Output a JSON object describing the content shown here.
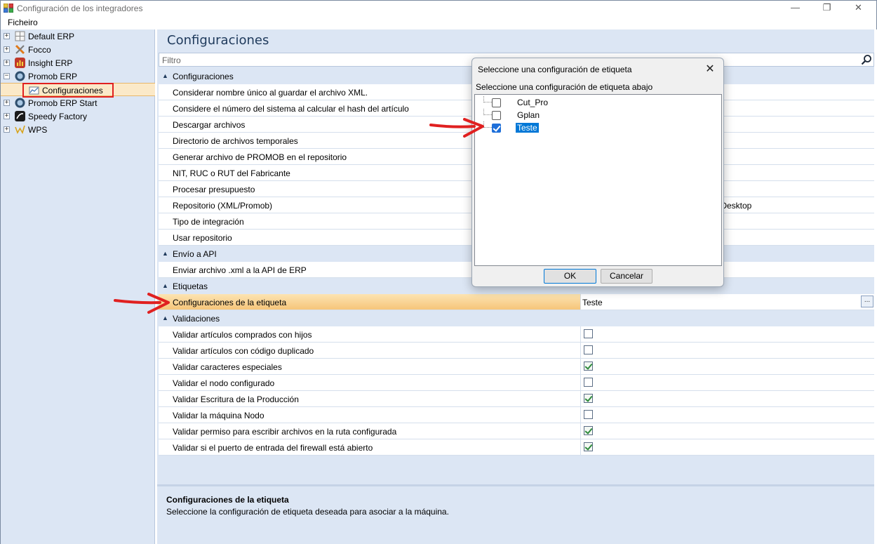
{
  "window": {
    "title": "Configuración de los integradores",
    "minimize_glyph": "—",
    "maximize_glyph": "❐",
    "close_glyph": "✕"
  },
  "menu": {
    "file": "Ficheiro"
  },
  "tree": {
    "items": [
      {
        "label": "Default ERP",
        "expander": "+",
        "icon": "default-erp-icon"
      },
      {
        "label": "Focco",
        "expander": "+",
        "icon": "focco-icon"
      },
      {
        "label": "Insight ERP",
        "expander": "+",
        "icon": "insight-erp-icon"
      },
      {
        "label": "Promob ERP",
        "expander": "−",
        "icon": "promob-erp-icon"
      },
      {
        "label": "Configuraciones",
        "icon": "chart-config-icon",
        "selected": true
      },
      {
        "label": "Promob ERP Start",
        "expander": "+",
        "icon": "promob-start-icon"
      },
      {
        "label": "Speedy Factory",
        "expander": "+",
        "icon": "speedy-factory-icon"
      },
      {
        "label": "WPS",
        "expander": "+",
        "icon": "wps-icon"
      }
    ]
  },
  "main": {
    "title": "Configuraciones",
    "filter_placeholder": "Filtro",
    "categories": {
      "configuraciones": "Configuraciones",
      "envio_api": "Envío a API",
      "etiquetas": "Etiquetas",
      "validaciones": "Validaciones"
    },
    "config_rows": [
      {
        "label": "Considerar nombre único al guardar el archivo XML.",
        "value": ""
      },
      {
        "label": "Considere el número del sistema al calcular el hash del artículo",
        "value": ""
      },
      {
        "label": "Descargar archivos",
        "value": ""
      },
      {
        "label": "Directorio de archivos temporales",
        "value": ""
      },
      {
        "label": "Generar archivo de PROMOB en el repositorio",
        "value": ""
      },
      {
        "label": "NIT, RUC o RUT del Fabricante",
        "value": ""
      },
      {
        "label": "Procesar presupuesto",
        "value": ""
      },
      {
        "label": "Repositorio (XML/Promob)",
        "value": "y\\Desktop"
      },
      {
        "label": "Tipo de integración",
        "value": ""
      },
      {
        "label": "Usar repositorio",
        "value": ""
      }
    ],
    "api_rows": [
      {
        "label": "Enviar archivo .xml a la API de ERP"
      }
    ],
    "label_rows": [
      {
        "label": "Configuraciones de la etiqueta",
        "value": "Teste",
        "button": "..."
      }
    ],
    "validation_rows": [
      {
        "label": "Validar artículos comprados con hijos",
        "checked": false
      },
      {
        "label": "Validar artículos con código duplicado",
        "checked": false
      },
      {
        "label": "Validar caracteres especiales",
        "checked": true
      },
      {
        "label": "Validar el nodo configurado",
        "checked": false
      },
      {
        "label": "Validar Escritura de la Producción",
        "checked": true
      },
      {
        "label": "Validar la máquina Nodo",
        "checked": false
      },
      {
        "label": "Validar permiso para escribir archivos en la ruta configurada",
        "checked": true
      },
      {
        "label": "Validar si el puerto de entrada del firewall está abierto",
        "checked": true
      }
    ]
  },
  "description": {
    "title": "Configuraciones de la etiqueta",
    "text": "Seleccione la configuración de etiqueta deseada para asociar a la máquina."
  },
  "dialog": {
    "title": "Seleccione una configuración de etiqueta",
    "subtitle": "Seleccione una configuración de etiqueta abajo",
    "close_glyph": "✕",
    "items": [
      {
        "label": "Cut_Pro",
        "checked": false
      },
      {
        "label": "Gplan",
        "checked": false
      },
      {
        "label": "Teste",
        "checked": true,
        "selected": true
      }
    ],
    "ok_label": "OK",
    "cancel_label": "Cancelar"
  },
  "colors": {
    "accent": "#e02020",
    "panel": "#dce6f4",
    "highlight": "#f6c57a"
  }
}
